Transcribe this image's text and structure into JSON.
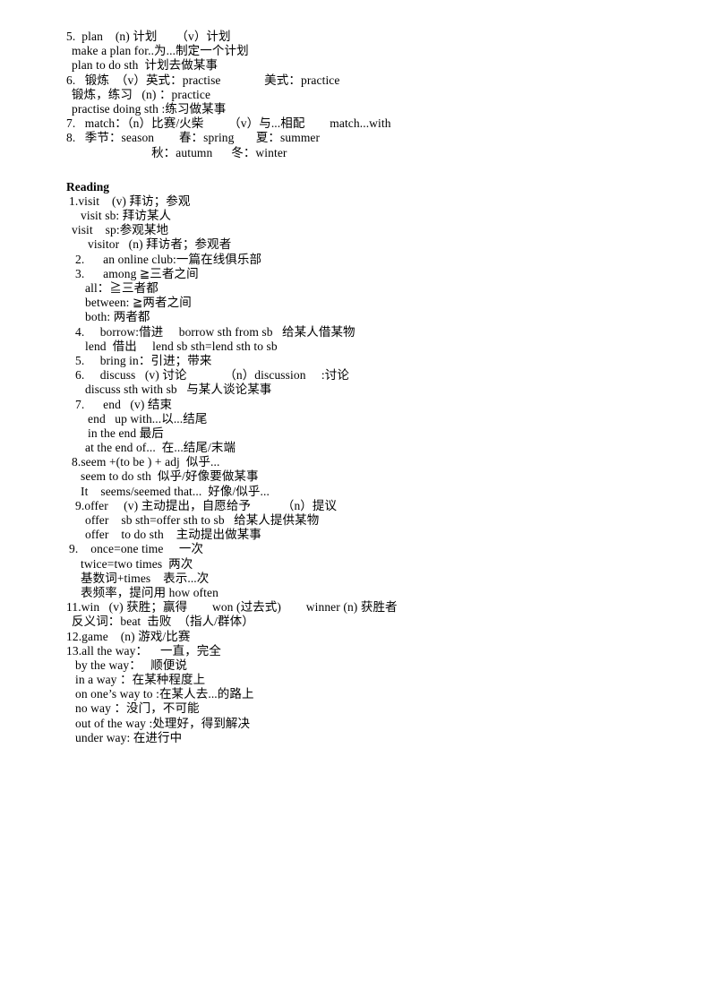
{
  "document": {
    "sections": [
      {
        "id": "vocabulary-continued",
        "lines": [
          {
            "indent": "i0",
            "text": "5.  plan    (n) 计划      （v）计划"
          },
          {
            "indent": "i2",
            "text": "make a plan for..为...制定一个计划"
          },
          {
            "indent": "i2",
            "text": "plan to do sth  计划去做某事"
          },
          {
            "indent": "i0",
            "text": "6.   锻炼  （v）英式：practise              美式：practice"
          },
          {
            "indent": "i2",
            "text": "锻炼，练习   (n) ：practice"
          },
          {
            "indent": "i2",
            "text": "practise doing sth :练习做某事"
          },
          {
            "indent": "i0",
            "text": "7.   match：（n）比赛/火柴        （v）与...相配        match...with"
          },
          {
            "indent": "i0",
            "text": "8.   季节：season        春：spring       夏：summer"
          },
          {
            "indent": "i8",
            "text": "                 秋：autumn      冬：winter"
          }
        ]
      },
      {
        "id": "reading",
        "heading": "Reading",
        "lines": [
          {
            "indent": "i1",
            "text": "1.visit    (v) 拜访；参观"
          },
          {
            "indent": "i4",
            "text": "visit sb: 拜访某人"
          },
          {
            "indent": "i2",
            "text": "visit    sp:参观某地"
          },
          {
            "indent": "i6",
            "text": "visitor   (n) 拜访者；参观者"
          },
          {
            "indent": "i3",
            "text": "2.      an online club:一篇在线俱乐部"
          },
          {
            "indent": "i3",
            "text": "3.      among ≧三者之间"
          },
          {
            "indent": "i5",
            "text": "all：≧三者都"
          },
          {
            "indent": "i5",
            "text": "between: ≧两者之间"
          },
          {
            "indent": "i5",
            "text": "both: 两者都"
          },
          {
            "indent": "i3",
            "text": "4.     borrow:借进     borrow sth from sb   给某人借某物"
          },
          {
            "indent": "i5",
            "text": "lend  借出     lend sb sth=lend sth to sb"
          },
          {
            "indent": "i3",
            "text": "5.     bring in：引进；带来"
          },
          {
            "indent": "i3",
            "text": "6.     discuss   (v) 讨论            （n）discussion     :讨论"
          },
          {
            "indent": "i5",
            "text": "discuss sth with sb   与某人谈论某事"
          },
          {
            "indent": "i3",
            "text": "7.      end   (v) 结束"
          },
          {
            "indent": "i6",
            "text": "end   up with...以...结尾"
          },
          {
            "indent": "i6",
            "text": "in the end 最后"
          },
          {
            "indent": "i5",
            "text": "at the end of...  在...结尾/末端"
          },
          {
            "indent": "i2",
            "text": "8.seem +(to be ) + adj  似乎..."
          },
          {
            "indent": "i4",
            "text": "seem to do sth  似乎/好像要做某事"
          },
          {
            "indent": "i4",
            "text": "It    seems/seemed that...  好像/似乎..."
          },
          {
            "indent": "i3",
            "text": "9.offer     (v) 主动提出，自愿给予          （n）提议"
          },
          {
            "indent": "i5",
            "text": "offer    sb sth=offer sth to sb   给某人提供某物"
          },
          {
            "indent": "i5",
            "text": "offer    to do sth    主动提出做某事"
          },
          {
            "indent": "i1",
            "text": "9.    once=one time     一次"
          },
          {
            "indent": "i4",
            "text": "twice=two times  两次"
          },
          {
            "indent": "i4",
            "text": "基数词+times    表示...次"
          },
          {
            "indent": "i4",
            "text": "表频率，提问用 how often"
          },
          {
            "indent": "i0",
            "text": "11.win   (v) 获胜；赢得        won (过去式)        winner (n) 获胜者"
          },
          {
            "indent": "i2",
            "text": "反义词：beat  击败  （指人/群体）"
          },
          {
            "indent": "i0",
            "text": "12.game    (n) 游戏/比赛"
          },
          {
            "indent": "i0",
            "text": "13.all the way：    一直，完全"
          },
          {
            "indent": "i3",
            "text": "by the way：   顺便说"
          },
          {
            "indent": "i3",
            "text": "in a way ：在某种程度上"
          },
          {
            "indent": "i3",
            "text": "on one’s way to :在某人去...的路上"
          },
          {
            "indent": "i3",
            "text": "no way ：没门，不可能"
          },
          {
            "indent": "i3",
            "text": "out of the way :处理好，得到解决"
          },
          {
            "indent": "i3",
            "text": "under way: 在进行中"
          }
        ]
      }
    ]
  }
}
